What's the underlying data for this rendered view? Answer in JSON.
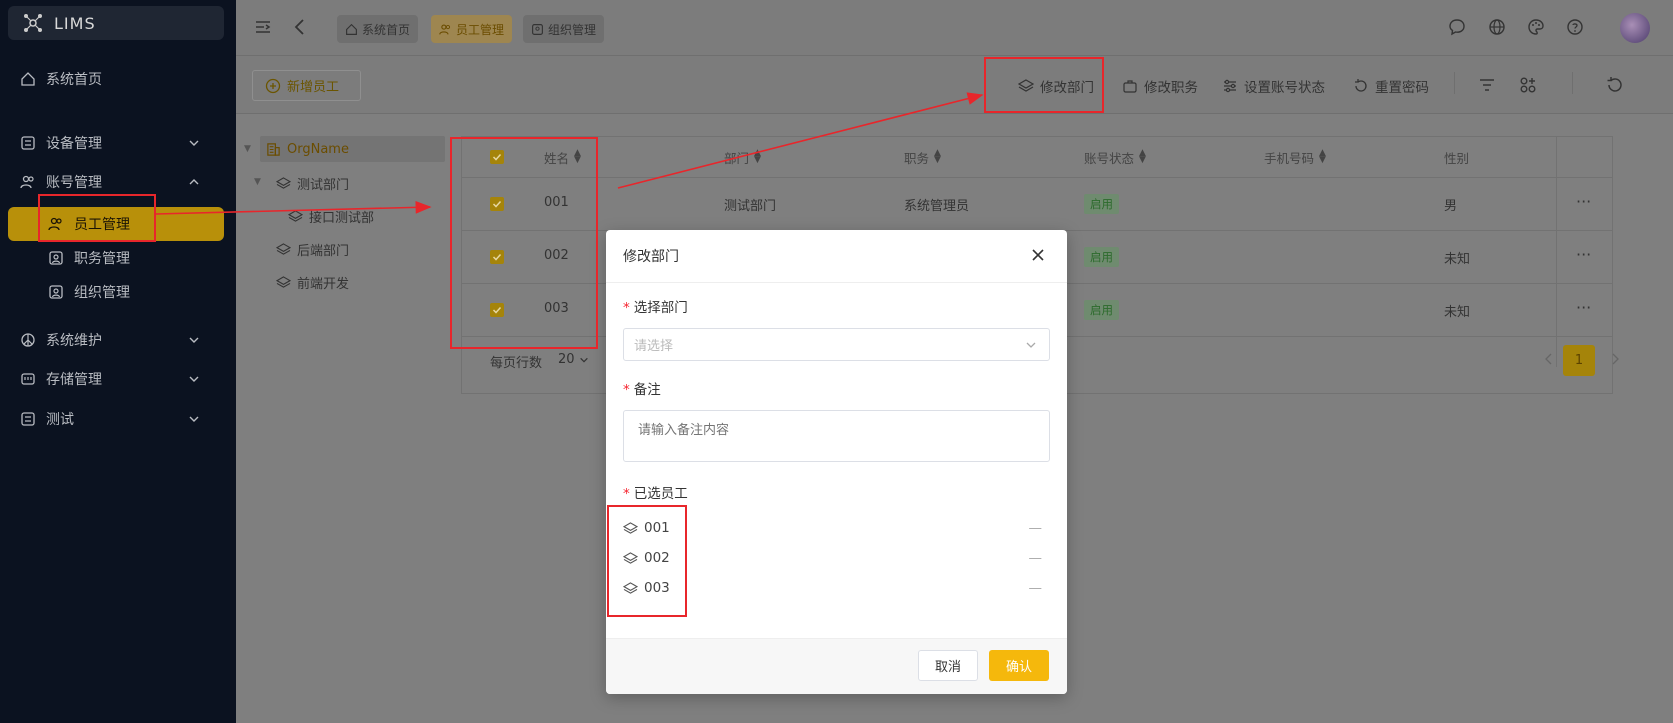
{
  "app": {
    "title": "LIMS"
  },
  "sidebar": {
    "items": [
      {
        "label": "系统首页"
      },
      {
        "label": "设备管理"
      },
      {
        "label": "账号管理"
      },
      {
        "label": "员工管理"
      },
      {
        "label": "职务管理"
      },
      {
        "label": "组织管理"
      },
      {
        "label": "系统维护"
      },
      {
        "label": "存储管理"
      },
      {
        "label": "测试"
      }
    ]
  },
  "tabs": [
    {
      "label": "系统首页"
    },
    {
      "label": "员工管理"
    },
    {
      "label": "组织管理"
    }
  ],
  "toolbar": {
    "add_label": "新增员工",
    "actions": [
      {
        "label": "修改部门"
      },
      {
        "label": "修改职务"
      },
      {
        "label": "设置账号状态"
      },
      {
        "label": "重置密码"
      }
    ]
  },
  "tree": {
    "root": "OrgName",
    "nodes": [
      {
        "label": "测试部门"
      },
      {
        "label": "接口测试部"
      },
      {
        "label": "后端部门"
      },
      {
        "label": "前端开发"
      }
    ]
  },
  "table": {
    "columns": [
      "姓名",
      "部门",
      "职务",
      "账号状态",
      "手机号码",
      "性别"
    ],
    "rows": [
      {
        "name": "001",
        "dept": "测试部门",
        "role": "系统管理员",
        "status": "启用",
        "gender": "男"
      },
      {
        "name": "002",
        "dept": "",
        "role": "",
        "status": "启用",
        "gender": "未知"
      },
      {
        "name": "003",
        "dept": "",
        "role": "",
        "status": "启用",
        "gender": "未知"
      }
    ],
    "page_size_label": "每页行数",
    "page_size": "20",
    "current_page": "1"
  },
  "dialog": {
    "title": "修改部门",
    "dept_label": "选择部门",
    "dept_placeholder": "请选择",
    "remark_label": "备注",
    "remark_placeholder": "请输入备注内容",
    "selected_label": "已选员工",
    "selected": [
      "001",
      "002",
      "003"
    ],
    "cancel": "取消",
    "ok": "确认"
  },
  "colors": {
    "accent": "#f5b80c",
    "annotation": "#e8262b",
    "sidebar_bg": "#0b1220"
  }
}
